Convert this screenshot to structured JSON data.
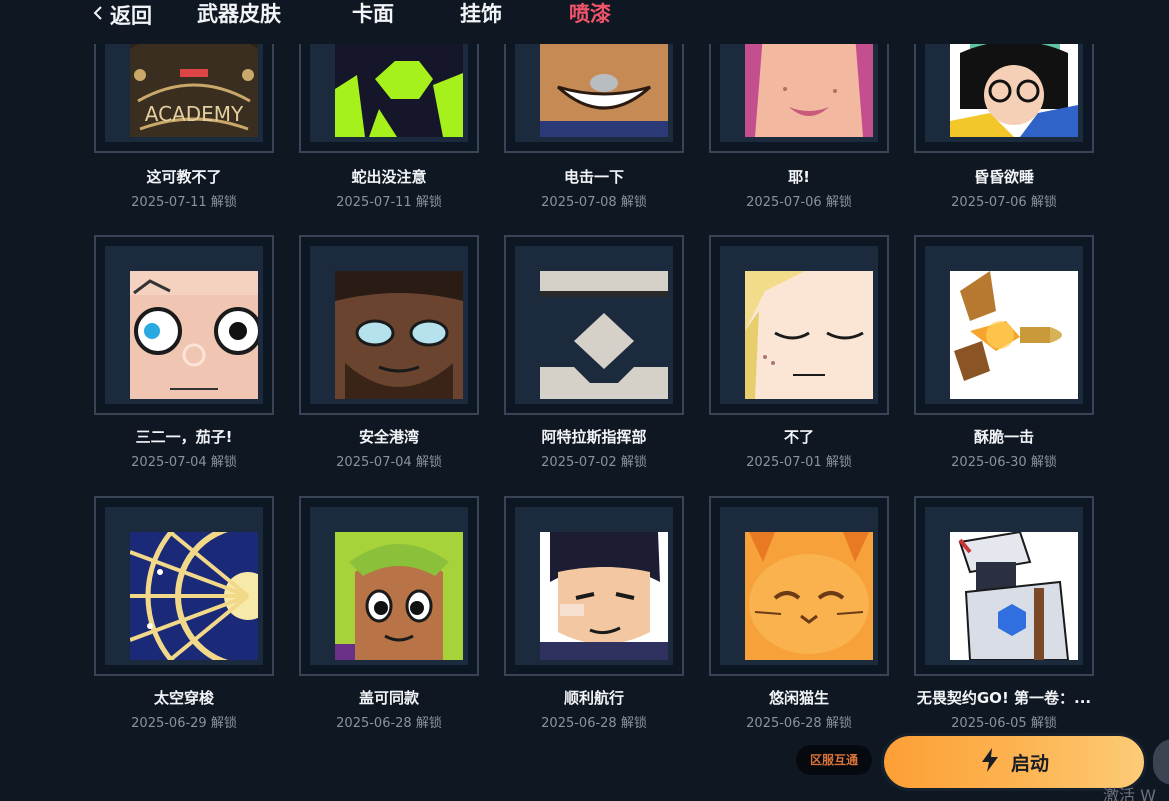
{
  "nav": {
    "back_label": "返回",
    "tabs": [
      {
        "label": "武器皮肤",
        "active": false
      },
      {
        "label": "卡面",
        "active": false
      },
      {
        "label": "挂饰",
        "active": false
      },
      {
        "label": "喷漆",
        "active": true
      }
    ]
  },
  "unlock_suffix": "解锁",
  "sprays": [
    {
      "title": "这可教不了",
      "date": "2025-07-11 解锁",
      "art": "academy-icon"
    },
    {
      "title": "蛇出没注意",
      "date": "2025-07-11 解锁",
      "art": "green-shapes-icon"
    },
    {
      "title": "电击一下",
      "date": "2025-07-08 解锁",
      "art": "grin-face-icon"
    },
    {
      "title": "耶!",
      "date": "2025-07-06 解锁",
      "art": "smile-face-icon"
    },
    {
      "title": "昏昏欲睡",
      "date": "2025-07-06 解锁",
      "art": "glasses-girl-icon"
    },
    {
      "title": "三二一，茄子!",
      "date": "2025-07-04 解锁",
      "art": "wide-eyes-icon"
    },
    {
      "title": "安全港湾",
      "date": "2025-07-04 解锁",
      "art": "bearded-face-icon"
    },
    {
      "title": "阿特拉斯指挥部",
      "date": "2025-07-02 解锁",
      "art": "hexagon-emblem-icon"
    },
    {
      "title": "不了",
      "date": "2025-07-01 解锁",
      "art": "sleepy-face-icon"
    },
    {
      "title": "酥脆一击",
      "date": "2025-06-30 解锁",
      "art": "bullet-icon"
    },
    {
      "title": "太空穿梭",
      "date": "2025-06-29 解锁",
      "art": "space-dial-icon"
    },
    {
      "title": "盖可同款",
      "date": "2025-06-28 解锁",
      "art": "green-hair-face-icon"
    },
    {
      "title": "顺利航行",
      "date": "2025-06-28 解锁",
      "art": "smirk-face-icon"
    },
    {
      "title": "悠闲猫生",
      "date": "2025-06-28 解锁",
      "art": "orange-cat-icon"
    },
    {
      "title": "无畏契约GO! 第一卷：...",
      "date": "2025-06-05 解锁",
      "art": "armored-agent-icon"
    }
  ],
  "actions": {
    "region_badge": "区服互通",
    "launch_label": "启动"
  },
  "watermark": "激活 W",
  "colors": {
    "background": "#0f1722",
    "active_tab": "#f0546b",
    "launch_gradient_start": "#fd9f35",
    "launch_gradient_end": "#fdcb78",
    "region_text": "#d9733a"
  }
}
